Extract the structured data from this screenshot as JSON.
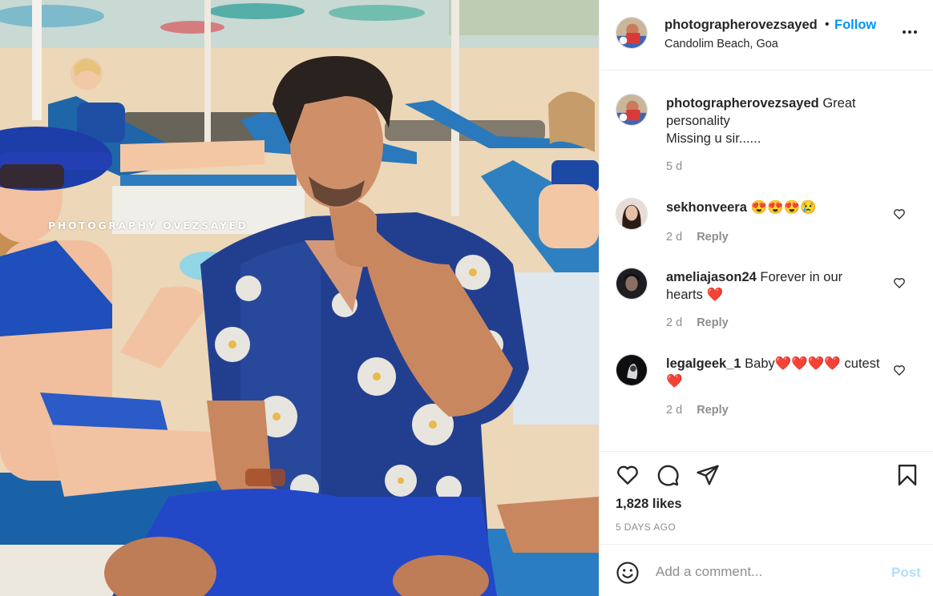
{
  "photo": {
    "watermark": "PHOTOGRAPHY OVEZSAYED"
  },
  "header": {
    "username": "photographerovezsayed",
    "separator": "•",
    "follow_label": "Follow",
    "location": "Candolim Beach, Goa",
    "more_icon": "more-horizontal-icon"
  },
  "caption": {
    "username": "photographerovezsayed",
    "text_line1": "Great personality",
    "text_line2": "Missing u sir......",
    "time": "5 d"
  },
  "comments": [
    {
      "username": "sekhonveera",
      "text": "😍😍😍😢",
      "time": "2 d",
      "reply_label": "Reply"
    },
    {
      "username": "ameliajason24",
      "text": "Forever in our hearts ❤️",
      "time": "2 d",
      "reply_label": "Reply"
    },
    {
      "username": "legalgeek_1",
      "text": "Baby❤️❤️❤️❤️ cutest❤️",
      "time": "2 d",
      "reply_label": "Reply"
    }
  ],
  "actions": {
    "like_icon": "heart-icon",
    "comment_icon": "comment-bubble-icon",
    "share_icon": "paper-plane-icon",
    "save_icon": "bookmark-icon",
    "likes_text": "1,828 likes",
    "posted_ago": "5 DAYS AGO"
  },
  "add_comment": {
    "emoji_icon": "smiley-icon",
    "placeholder": "Add a comment...",
    "post_label": "Post"
  },
  "colors": {
    "link_blue": "#0095f6",
    "post_disabled": "#b2dffc",
    "meta_gray": "#8e8e8e",
    "text": "#262626",
    "heart_red": "#ed4956"
  }
}
